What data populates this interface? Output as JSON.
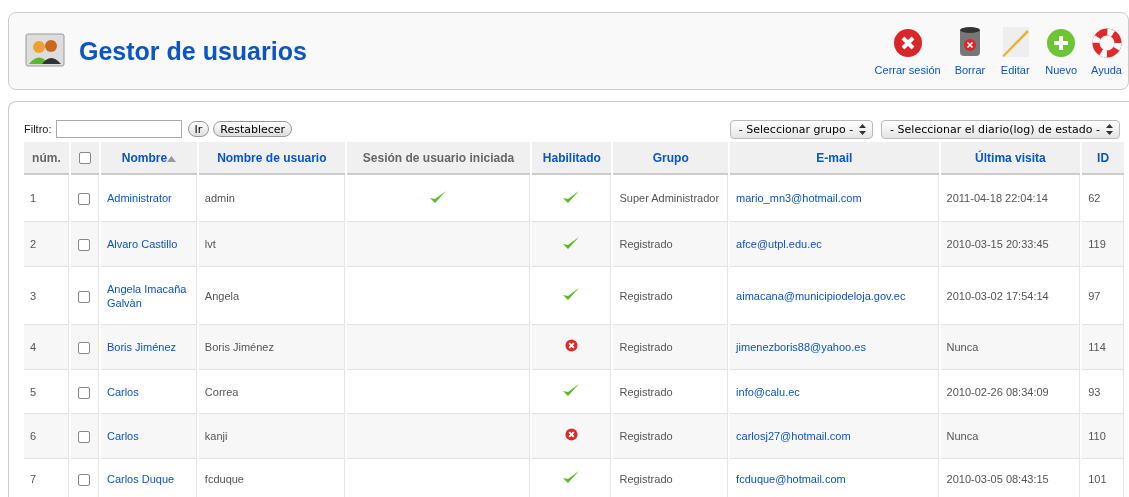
{
  "header": {
    "title": "Gestor de usuarios"
  },
  "toolbar": [
    {
      "label": "Cerrar sesión",
      "kind": "logout"
    },
    {
      "label": "Borrar",
      "kind": "trash"
    },
    {
      "label": "Editar",
      "kind": "edit"
    },
    {
      "label": "Nuevo",
      "kind": "new"
    },
    {
      "label": "Ayuda",
      "kind": "help"
    }
  ],
  "filter": {
    "label": "Filtro:",
    "buttons": [
      "Ir",
      "Restablecer"
    ],
    "selects": [
      "- Seleccionar grupo -",
      "- Seleccionar el diario(log) de estado -"
    ]
  },
  "table": {
    "columns": [
      {
        "label": "núm.",
        "kind": "text",
        "sortable": false
      },
      {
        "kind": "checkbox",
        "checked": false
      },
      {
        "label": "Nombre",
        "kind": "text",
        "sortable": true,
        "sorted": true
      },
      {
        "label": "Nombre de usuario",
        "kind": "text",
        "sortable": true
      },
      {
        "label": "Sesión de usuario iniciada",
        "kind": "text",
        "sortable": false
      },
      {
        "label": "Habilitado",
        "kind": "text",
        "sortable": true
      },
      {
        "label": "Grupo",
        "kind": "text",
        "sortable": true
      },
      {
        "label": "E-mail",
        "kind": "text",
        "sortable": true
      },
      {
        "label": "Última visita",
        "kind": "text",
        "sortable": true
      },
      {
        "label": "ID",
        "kind": "text",
        "sortable": true
      }
    ],
    "rows": [
      {
        "num": "1",
        "checked": false,
        "name": "Administrator",
        "username": "admin",
        "logged_in": true,
        "enabled": true,
        "group": "Super Administrador",
        "email": "mario_mn3@hotmail.com",
        "last_visit": "2011-04-18 22:04:14",
        "id": "62"
      },
      {
        "num": "2",
        "checked": false,
        "name": "Alvaro Castillo",
        "username": "lvt",
        "logged_in": false,
        "enabled": true,
        "group": "Registrado",
        "email": "afce@utpl.edu.ec",
        "last_visit": "2010-03-15 20:33:45",
        "id": "119"
      },
      {
        "num": "3",
        "checked": false,
        "name": "Angela Imacaña Galvàn",
        "username": "Angela",
        "logged_in": false,
        "enabled": true,
        "group": "Registrado",
        "email": "aimacana@municipiodeloja.gov.ec",
        "last_visit": "2010-03-02 17:54:14",
        "id": "97"
      },
      {
        "num": "4",
        "checked": false,
        "name": "Boris Jiménez",
        "username": "Boris Jiménez",
        "logged_in": false,
        "enabled": false,
        "group": "Registrado",
        "email": "jimenezboris88@yahoo.es",
        "last_visit": "Nunca",
        "id": "114"
      },
      {
        "num": "5",
        "checked": false,
        "name": "Carlos",
        "username": "Correa",
        "logged_in": false,
        "enabled": true,
        "group": "Registrado",
        "email": "info@calu.ec",
        "last_visit": "2010-02-26 08:34:09",
        "id": "93"
      },
      {
        "num": "6",
        "checked": false,
        "name": "Carlos",
        "username": "kanji",
        "logged_in": false,
        "enabled": false,
        "group": "Registrado",
        "email": "carlosj27@hotmail.com",
        "last_visit": "Nunca",
        "id": "110"
      },
      {
        "num": "7",
        "checked": false,
        "name": "Carlos Duque",
        "username": "fcduque",
        "logged_in": false,
        "enabled": true,
        "group": "Registrado",
        "email": "fcduque@hotmail.com",
        "last_visit": "2010-03-05 08:43:15",
        "id": "101"
      }
    ]
  }
}
